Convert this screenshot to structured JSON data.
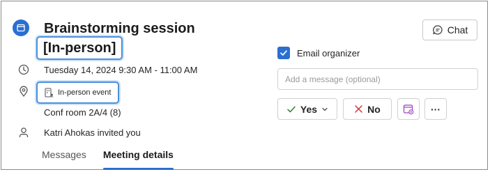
{
  "meeting": {
    "title": "Brainstorming session",
    "subtitle": "[In-person]",
    "datetime": "Tuesday 14, 2024 9:30 AM - 11:00 AM",
    "location_chip": "In-person event",
    "room": "Conf room 2A/4 (8)",
    "organizer_text": "Katri Ahokas invited you"
  },
  "tabs": [
    {
      "label": "Messages",
      "active": false
    },
    {
      "label": "Meeting details",
      "active": true
    }
  ],
  "actions": {
    "chat_label": "Chat",
    "email_organizer_label": "Email organizer",
    "email_organizer_checked": true,
    "message_placeholder": "Add a message (optional)",
    "yes_label": "Yes",
    "no_label": "No",
    "more_label": "···"
  },
  "icons": {
    "calendar": "calendar-icon",
    "clock": "clock-icon",
    "location": "location-pin-icon",
    "person": "person-icon",
    "chat": "chat-bubble-icon",
    "checkmark": "checkmark-icon",
    "dismiss": "x-icon",
    "calendar_view": "calendar-view-icon",
    "more": "more-horizontal-icon"
  },
  "colors": {
    "accent": "#2a6fd1",
    "highlight": "#4a90d9",
    "yes_green": "#2e7d32",
    "no_red": "#d13438",
    "calendar_view_purple": "#9b3fbf"
  }
}
